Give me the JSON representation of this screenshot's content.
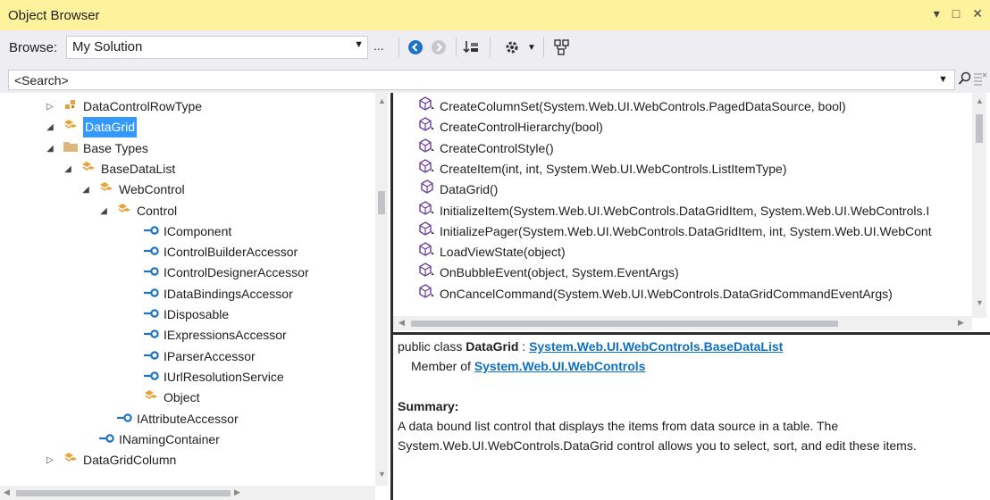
{
  "window": {
    "title": "Object Browser",
    "buttons": [
      "▾",
      "□",
      "✕"
    ]
  },
  "toolbar": {
    "browse_label": "Browse:",
    "browse_value": "My Solution",
    "ellipsis": "...",
    "icons": [
      "back-icon",
      "forward-icon",
      "sort-icon",
      "settings-icon",
      "add-reference-icon"
    ]
  },
  "search": {
    "placeholder": "<Search>",
    "value": "<Search>"
  },
  "tree": {
    "items": [
      {
        "label": "DataControlRowType",
        "icon": "enum-icon",
        "expander": "▷",
        "indent": 0
      },
      {
        "label": "DataGrid",
        "icon": "class-icon",
        "expander": "◢",
        "indent": 0,
        "selected": true
      },
      {
        "label": "Base Types",
        "icon": "folder-icon",
        "expander": "◢",
        "indent": 1
      },
      {
        "label": "BaseDataList",
        "icon": "class-icon",
        "expander": "◢",
        "indent": 2
      },
      {
        "label": "WebControl",
        "icon": "class-icon",
        "expander": "◢",
        "indent": 3
      },
      {
        "label": "Control",
        "icon": "class-icon",
        "expander": "◢",
        "indent": 4
      },
      {
        "label": "IComponent",
        "icon": "interface-icon",
        "indent": 5
      },
      {
        "label": "IControlBuilderAccessor",
        "icon": "interface-icon",
        "indent": 5
      },
      {
        "label": "IControlDesignerAccessor",
        "icon": "interface-icon",
        "indent": 5
      },
      {
        "label": "IDataBindingsAccessor",
        "icon": "interface-icon",
        "indent": 5
      },
      {
        "label": "IDisposable",
        "icon": "interface-icon",
        "indent": 5
      },
      {
        "label": "IExpressionsAccessor",
        "icon": "interface-icon",
        "indent": 5
      },
      {
        "label": "IParserAccessor",
        "icon": "interface-icon",
        "indent": 5
      },
      {
        "label": "IUrlResolutionService",
        "icon": "interface-icon",
        "indent": 5
      },
      {
        "label": "Object",
        "icon": "class-icon",
        "indent": 5
      },
      {
        "label": "IAttributeAccessor",
        "icon": "interface-icon",
        "indent": 4
      },
      {
        "label": "INamingContainer",
        "icon": "interface-icon",
        "indent": 3
      },
      {
        "label": "DataGridColumn",
        "icon": "class-icon",
        "expander": "▷",
        "indent": 0
      }
    ]
  },
  "members": {
    "items": [
      {
        "label": "CreateColumnSet(System.Web.UI.WebControls.PagedDataSource, bool)",
        "icon": "protected-method-icon"
      },
      {
        "label": "CreateControlHierarchy(bool)",
        "icon": "protected-method-icon"
      },
      {
        "label": "CreateControlStyle()",
        "icon": "protected-method-icon"
      },
      {
        "label": "CreateItem(int, int, System.Web.UI.WebControls.ListItemType)",
        "icon": "protected-method-icon"
      },
      {
        "label": "DataGrid()",
        "icon": "method-icon"
      },
      {
        "label": "InitializeItem(System.Web.UI.WebControls.DataGridItem, System.Web.UI.WebControls.I",
        "icon": "protected-method-icon"
      },
      {
        "label": "InitializePager(System.Web.UI.WebControls.DataGridItem, int, System.Web.UI.WebCont",
        "icon": "protected-method-icon"
      },
      {
        "label": "LoadViewState(object)",
        "icon": "protected-method-icon"
      },
      {
        "label": "OnBubbleEvent(object, System.EventArgs)",
        "icon": "protected-method-icon"
      },
      {
        "label": "OnCancelCommand(System.Web.UI.WebControls.DataGridCommandEventArgs)",
        "icon": "protected-method-icon"
      }
    ]
  },
  "details": {
    "decl_prefix": "public class ",
    "decl_name": "DataGrid",
    "decl_sep": " : ",
    "base_link": "System.Web.UI.WebControls.BaseDataList",
    "member_of_prefix": "Member of ",
    "namespace_link": "System.Web.UI.WebControls",
    "summary_heading": "Summary:",
    "summary_line1": "A data bound list control that displays the items from data source in a table. The",
    "summary_line2": "System.Web.UI.WebControls.DataGrid control allows you to select, sort, and edit these items."
  },
  "colors": {
    "title_bar": "#fff29d",
    "selection": "#3399ff",
    "link": "#0e70c0",
    "class_icon": "#e8a33d",
    "interface_icon": "#1c73c8",
    "method_icon": "#6c3fa0"
  }
}
